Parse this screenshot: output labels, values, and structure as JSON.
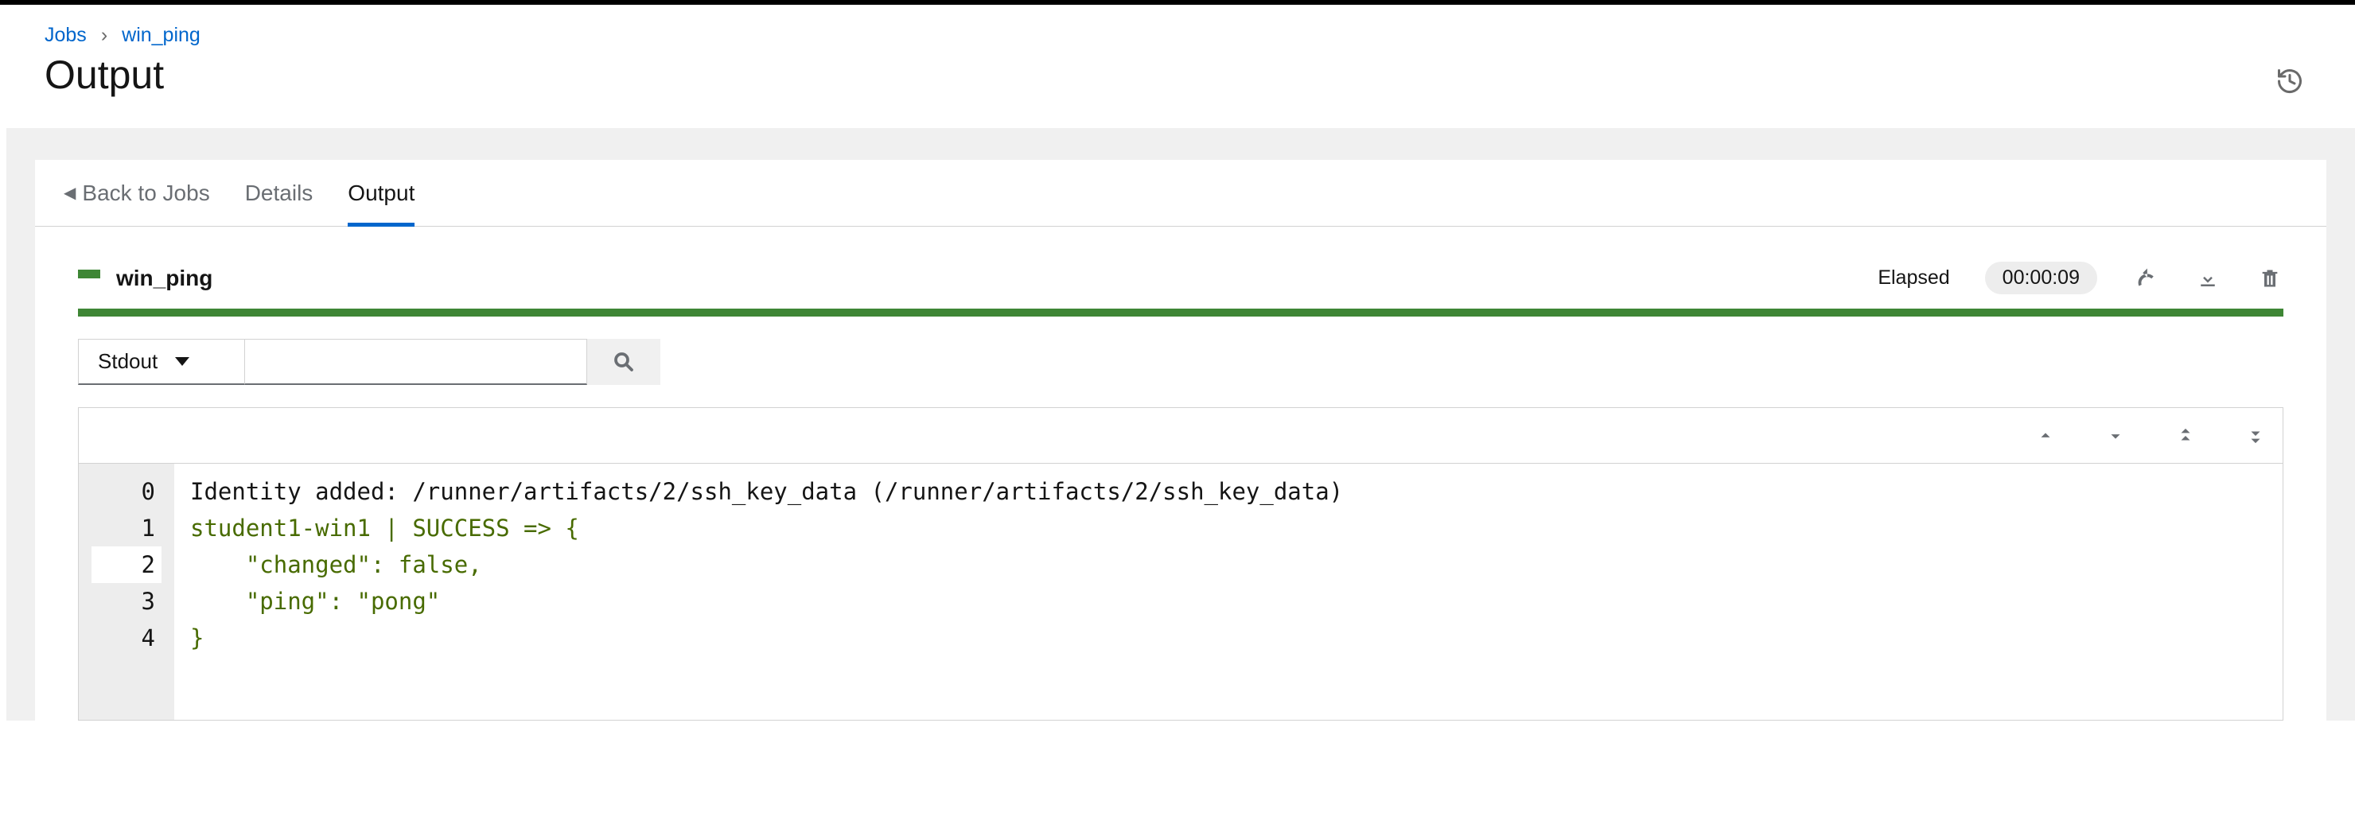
{
  "breadcrumb": {
    "jobs": "Jobs",
    "sep": "›",
    "current": "win_ping"
  },
  "page_title": "Output",
  "tabs": {
    "back": "Back to Jobs",
    "details": "Details",
    "output": "Output"
  },
  "job": {
    "name": "win_ping",
    "elapsed_label": "Elapsed",
    "elapsed_value": "00:00:09"
  },
  "filter": {
    "selected": "Stdout"
  },
  "output_lines": {
    "l0_num": "0",
    "l0": "Identity added: /runner/artifacts/2/ssh_key_data (/runner/artifacts/2/ssh_key_data)",
    "l1_num": "1",
    "l1": "student1-win1 | SUCCESS => {",
    "l2_num": "2",
    "l2": "    \"changed\": false,",
    "l3_num": "3",
    "l3": "    \"ping\": \"pong\"",
    "l4_num": "4",
    "l4": "}"
  }
}
